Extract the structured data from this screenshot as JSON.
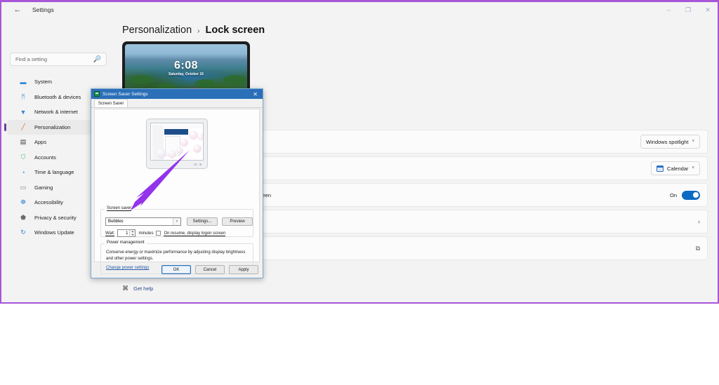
{
  "window": {
    "title": "Settings",
    "back_icon": "back-arrow-icon",
    "minimize": "–",
    "maximize": "❐",
    "close": "✕"
  },
  "search": {
    "placeholder": "Find a setting",
    "icon": "search-icon"
  },
  "sidebar": {
    "items": [
      {
        "label": "System",
        "icon": "monitor-icon",
        "glyph": "▬",
        "color": "#2f86d8",
        "active": false
      },
      {
        "label": "Bluetooth & devices",
        "icon": "bluetooth-icon",
        "glyph": "ᛗ",
        "color": "#2f86d8",
        "active": false
      },
      {
        "label": "Network & internet",
        "icon": "wifi-icon",
        "glyph": "▼",
        "color": "#2f86d8",
        "active": false
      },
      {
        "label": "Personalization",
        "icon": "paintbrush-icon",
        "glyph": "╱",
        "color": "#e0702a",
        "active": true
      },
      {
        "label": "Apps",
        "icon": "apps-icon",
        "glyph": "▤",
        "color": "#3a3a3a",
        "active": false
      },
      {
        "label": "Accounts",
        "icon": "account-icon",
        "glyph": "⛉",
        "color": "#3bb273",
        "active": false
      },
      {
        "label": "Time & language",
        "icon": "clock-icon",
        "glyph": "◔",
        "color": "#2f86d8",
        "active": false
      },
      {
        "label": "Gaming",
        "icon": "gamepad-icon",
        "glyph": "▭",
        "color": "#7a7a8c",
        "active": false
      },
      {
        "label": "Accessibility",
        "icon": "accessibility-icon",
        "glyph": "☸",
        "color": "#2f86d8",
        "active": false
      },
      {
        "label": "Privacy & security",
        "icon": "shield-icon",
        "glyph": "⬟",
        "color": "#6a6a72",
        "active": false
      },
      {
        "label": "Windows Update",
        "icon": "update-icon",
        "glyph": "↻",
        "color": "#2f86d8",
        "active": false
      }
    ]
  },
  "breadcrumb": {
    "parent": "Personalization",
    "separator": "›",
    "current": "Lock screen"
  },
  "lock_preview": {
    "time": "6:08",
    "date": "Saturday, October 16"
  },
  "settings_rows": [
    {
      "name": "personalize-lock-screen-row",
      "control": "dropdown",
      "value": "Windows spotlight",
      "chevron": "˅",
      "has_icon": false
    },
    {
      "name": "lock-screen-status-row",
      "control": "dropdown",
      "value": "Calendar",
      "chevron": "˅",
      "has_icon": true,
      "icon": "calendar-icon"
    },
    {
      "name": "lock-screen-picture-signin-row",
      "control": "toggle",
      "partial_label": "reen",
      "toggle_state": "On"
    },
    {
      "name": "screen-timeout-row",
      "control": "chevron",
      "chevron": "›"
    },
    {
      "name": "screen-saver-row",
      "control": "external-link",
      "icon": "external-link-icon",
      "glyph": "⧉"
    }
  ],
  "get_help": {
    "label": "Get help",
    "icon": "help-icon",
    "glyph": "⌘"
  },
  "dialog": {
    "title": "Screen Saver Settings",
    "icon": "screensaver-icon",
    "close": "✕",
    "tab": "Screen Saver",
    "screen_saver_group": {
      "legend": "Screen saver",
      "selected": "Bubbles",
      "dropdown_arrow": "˅",
      "settings_button": "Settings...",
      "preview_button": "Preview",
      "wait_label": "Wait:",
      "wait_value": "1",
      "minutes_label": "minutes",
      "spin_up": "▲",
      "spin_down": "▼",
      "logon_checkbox_label": "On resume, display logon screen",
      "logon_checked": false
    },
    "power_group": {
      "legend": "Power management",
      "description": "Conserve energy or maximize performance by adjusting display brightness and other power settings.",
      "link": "Change power settings"
    },
    "buttons": {
      "ok": "OK",
      "cancel": "Cancel",
      "apply": "Apply"
    }
  },
  "annotation": {
    "arrow_color": "#9333ea",
    "name": "purple-arrow-annotation"
  },
  "colors": {
    "accent_purple": "#a855d8",
    "dialog_blue": "#2a6fb8",
    "toggle_blue": "#0b6bc4",
    "link_blue": "#2558a8"
  }
}
